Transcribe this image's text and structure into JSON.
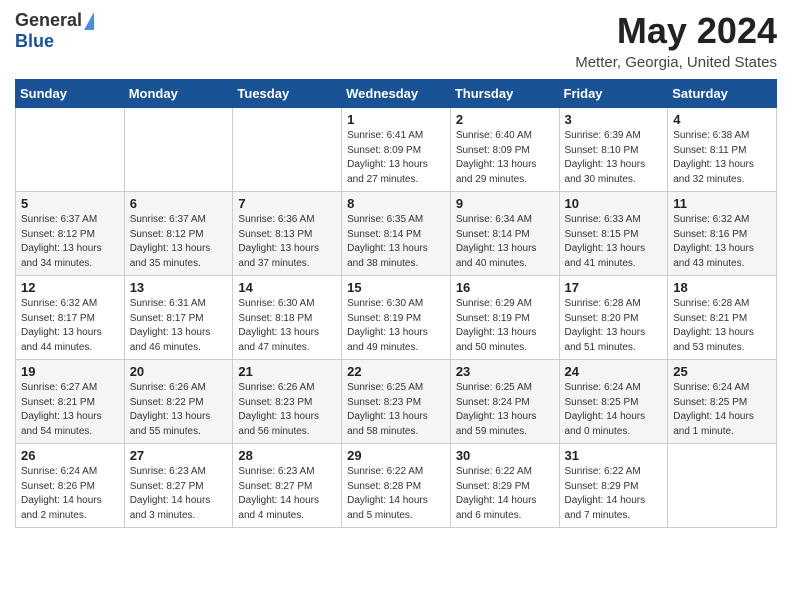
{
  "header": {
    "logo_general": "General",
    "logo_blue": "Blue",
    "month_title": "May 2024",
    "location": "Metter, Georgia, United States"
  },
  "days_of_week": [
    "Sunday",
    "Monday",
    "Tuesday",
    "Wednesday",
    "Thursday",
    "Friday",
    "Saturday"
  ],
  "weeks": [
    [
      {
        "day": "",
        "info": ""
      },
      {
        "day": "",
        "info": ""
      },
      {
        "day": "",
        "info": ""
      },
      {
        "day": "1",
        "info": "Sunrise: 6:41 AM\nSunset: 8:09 PM\nDaylight: 13 hours\nand 27 minutes."
      },
      {
        "day": "2",
        "info": "Sunrise: 6:40 AM\nSunset: 8:09 PM\nDaylight: 13 hours\nand 29 minutes."
      },
      {
        "day": "3",
        "info": "Sunrise: 6:39 AM\nSunset: 8:10 PM\nDaylight: 13 hours\nand 30 minutes."
      },
      {
        "day": "4",
        "info": "Sunrise: 6:38 AM\nSunset: 8:11 PM\nDaylight: 13 hours\nand 32 minutes."
      }
    ],
    [
      {
        "day": "5",
        "info": "Sunrise: 6:37 AM\nSunset: 8:12 PM\nDaylight: 13 hours\nand 34 minutes."
      },
      {
        "day": "6",
        "info": "Sunrise: 6:37 AM\nSunset: 8:12 PM\nDaylight: 13 hours\nand 35 minutes."
      },
      {
        "day": "7",
        "info": "Sunrise: 6:36 AM\nSunset: 8:13 PM\nDaylight: 13 hours\nand 37 minutes."
      },
      {
        "day": "8",
        "info": "Sunrise: 6:35 AM\nSunset: 8:14 PM\nDaylight: 13 hours\nand 38 minutes."
      },
      {
        "day": "9",
        "info": "Sunrise: 6:34 AM\nSunset: 8:14 PM\nDaylight: 13 hours\nand 40 minutes."
      },
      {
        "day": "10",
        "info": "Sunrise: 6:33 AM\nSunset: 8:15 PM\nDaylight: 13 hours\nand 41 minutes."
      },
      {
        "day": "11",
        "info": "Sunrise: 6:32 AM\nSunset: 8:16 PM\nDaylight: 13 hours\nand 43 minutes."
      }
    ],
    [
      {
        "day": "12",
        "info": "Sunrise: 6:32 AM\nSunset: 8:17 PM\nDaylight: 13 hours\nand 44 minutes."
      },
      {
        "day": "13",
        "info": "Sunrise: 6:31 AM\nSunset: 8:17 PM\nDaylight: 13 hours\nand 46 minutes."
      },
      {
        "day": "14",
        "info": "Sunrise: 6:30 AM\nSunset: 8:18 PM\nDaylight: 13 hours\nand 47 minutes."
      },
      {
        "day": "15",
        "info": "Sunrise: 6:30 AM\nSunset: 8:19 PM\nDaylight: 13 hours\nand 49 minutes."
      },
      {
        "day": "16",
        "info": "Sunrise: 6:29 AM\nSunset: 8:19 PM\nDaylight: 13 hours\nand 50 minutes."
      },
      {
        "day": "17",
        "info": "Sunrise: 6:28 AM\nSunset: 8:20 PM\nDaylight: 13 hours\nand 51 minutes."
      },
      {
        "day": "18",
        "info": "Sunrise: 6:28 AM\nSunset: 8:21 PM\nDaylight: 13 hours\nand 53 minutes."
      }
    ],
    [
      {
        "day": "19",
        "info": "Sunrise: 6:27 AM\nSunset: 8:21 PM\nDaylight: 13 hours\nand 54 minutes."
      },
      {
        "day": "20",
        "info": "Sunrise: 6:26 AM\nSunset: 8:22 PM\nDaylight: 13 hours\nand 55 minutes."
      },
      {
        "day": "21",
        "info": "Sunrise: 6:26 AM\nSunset: 8:23 PM\nDaylight: 13 hours\nand 56 minutes."
      },
      {
        "day": "22",
        "info": "Sunrise: 6:25 AM\nSunset: 8:23 PM\nDaylight: 13 hours\nand 58 minutes."
      },
      {
        "day": "23",
        "info": "Sunrise: 6:25 AM\nSunset: 8:24 PM\nDaylight: 13 hours\nand 59 minutes."
      },
      {
        "day": "24",
        "info": "Sunrise: 6:24 AM\nSunset: 8:25 PM\nDaylight: 14 hours\nand 0 minutes."
      },
      {
        "day": "25",
        "info": "Sunrise: 6:24 AM\nSunset: 8:25 PM\nDaylight: 14 hours\nand 1 minute."
      }
    ],
    [
      {
        "day": "26",
        "info": "Sunrise: 6:24 AM\nSunset: 8:26 PM\nDaylight: 14 hours\nand 2 minutes."
      },
      {
        "day": "27",
        "info": "Sunrise: 6:23 AM\nSunset: 8:27 PM\nDaylight: 14 hours\nand 3 minutes."
      },
      {
        "day": "28",
        "info": "Sunrise: 6:23 AM\nSunset: 8:27 PM\nDaylight: 14 hours\nand 4 minutes."
      },
      {
        "day": "29",
        "info": "Sunrise: 6:22 AM\nSunset: 8:28 PM\nDaylight: 14 hours\nand 5 minutes."
      },
      {
        "day": "30",
        "info": "Sunrise: 6:22 AM\nSunset: 8:29 PM\nDaylight: 14 hours\nand 6 minutes."
      },
      {
        "day": "31",
        "info": "Sunrise: 6:22 AM\nSunset: 8:29 PM\nDaylight: 14 hours\nand 7 minutes."
      },
      {
        "day": "",
        "info": ""
      }
    ]
  ]
}
